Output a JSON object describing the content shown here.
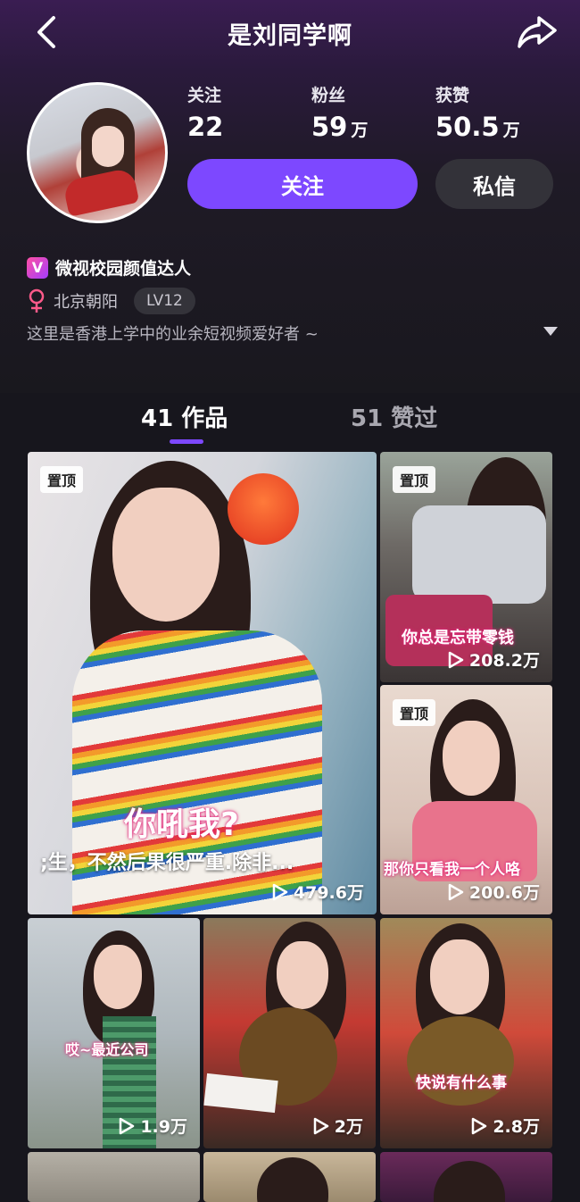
{
  "header": {
    "title": "是刘同学啊"
  },
  "stats": [
    {
      "label": "关注",
      "value": "22",
      "unit": ""
    },
    {
      "label": "粉丝",
      "value": "59",
      "unit": "万"
    },
    {
      "label": "获赞",
      "value": "50.5",
      "unit": "万"
    }
  ],
  "actions": {
    "follow_label": "关注",
    "message_label": "私信"
  },
  "profile": {
    "certification_badge": "V",
    "certification": "微视校园颜值达人",
    "location": "北京朝阳",
    "level": "LV12",
    "bio": "这里是香港上学中的业余短视频爱好者 ~"
  },
  "tabs": [
    {
      "count": "41",
      "label": "作品"
    },
    {
      "count": "51",
      "label": "赞过"
    }
  ],
  "videos": [
    {
      "pinned": "置顶",
      "caption": ";生，不然后果很严重.除非...",
      "overlay": "你吼我?",
      "plays": "479.6万"
    },
    {
      "pinned": "置顶",
      "caption": "你总是忘带零钱",
      "plays": "208.2万"
    },
    {
      "pinned": "置顶",
      "caption": "那你只看我一个人咯",
      "plays": "200.6万"
    },
    {
      "caption": "哎~最近公司",
      "plays": "1.9万"
    },
    {
      "caption": "",
      "plays": "2万"
    },
    {
      "caption": "快说有什么事",
      "plays": "2.8万"
    }
  ],
  "colors": {
    "accent": "#7d48ff",
    "background": "#17161d",
    "female_icon": "#ff5a8a"
  },
  "icons": {
    "back": "chevron-left-icon",
    "share": "share-arrow-icon",
    "gender": "female-icon",
    "expand": "triangle-down-icon",
    "play": "play-outline-icon"
  }
}
